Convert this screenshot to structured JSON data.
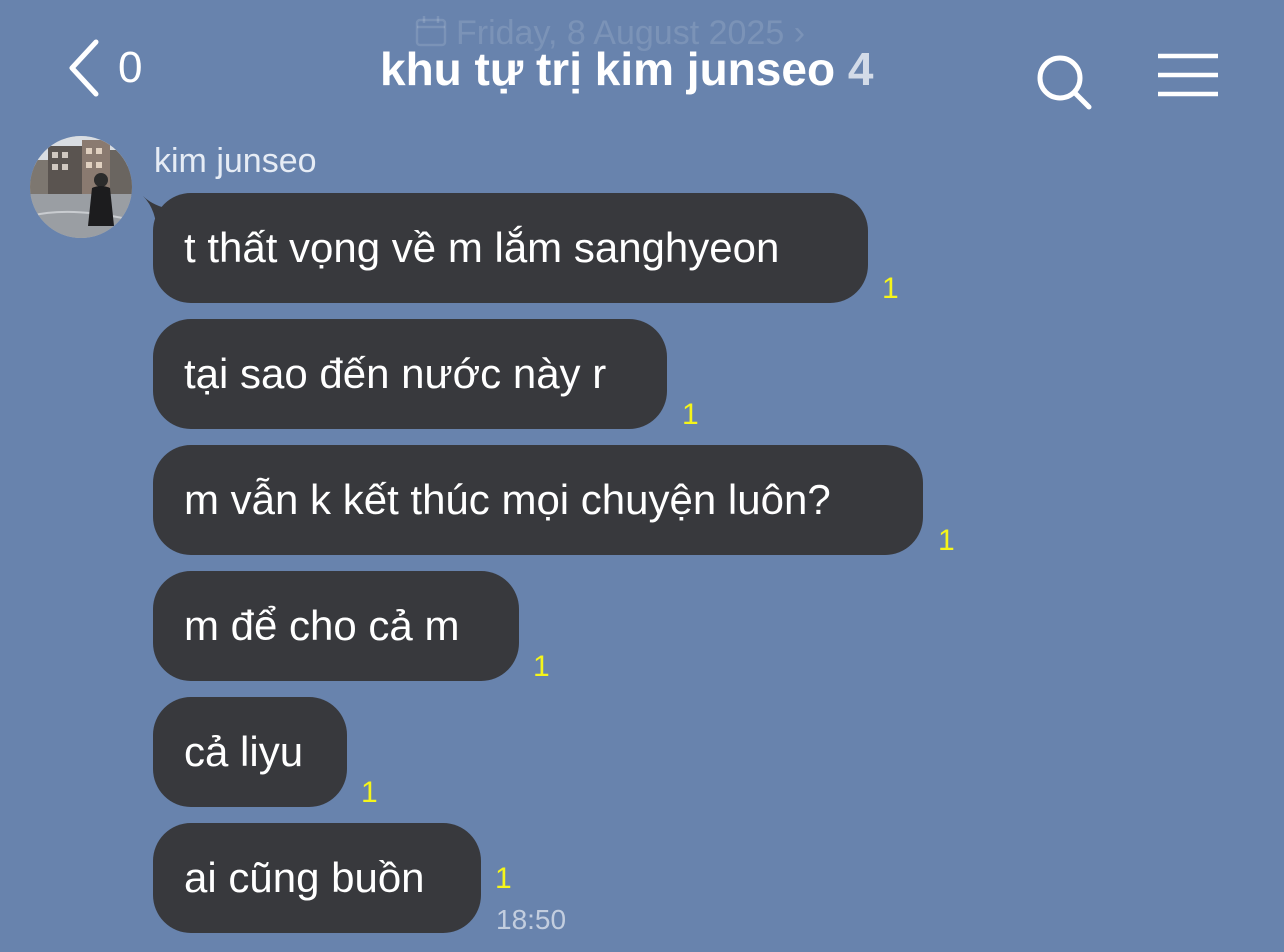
{
  "date_banner": "Friday, 8 August 2025",
  "header": {
    "back_count": "0",
    "chat_name": "khu tự trị kim junseo",
    "member_count": "4"
  },
  "icons": {
    "back": "chevron-left-icon",
    "search": "search-icon",
    "menu": "hamburger-menu-icon",
    "calendar": "calendar-icon"
  },
  "colors": {
    "background": "#6883ad",
    "bubble": "#38393d",
    "unread": "#f5f51a"
  },
  "chat": {
    "sender_name": "kim junseo",
    "messages": [
      {
        "text": "t thất vọng về m lắm sanghyeon",
        "unread": "1"
      },
      {
        "text": "tại sao đến nước này r",
        "unread": "1"
      },
      {
        "text": "m vẫn k kết thúc mọi chuyện luôn?",
        "unread": "1"
      },
      {
        "text": "m để cho cả m",
        "unread": "1"
      },
      {
        "text": "cả liyu",
        "unread": "1"
      },
      {
        "text": "ai cũng buồn",
        "unread": "1",
        "time": "18:50"
      }
    ]
  }
}
